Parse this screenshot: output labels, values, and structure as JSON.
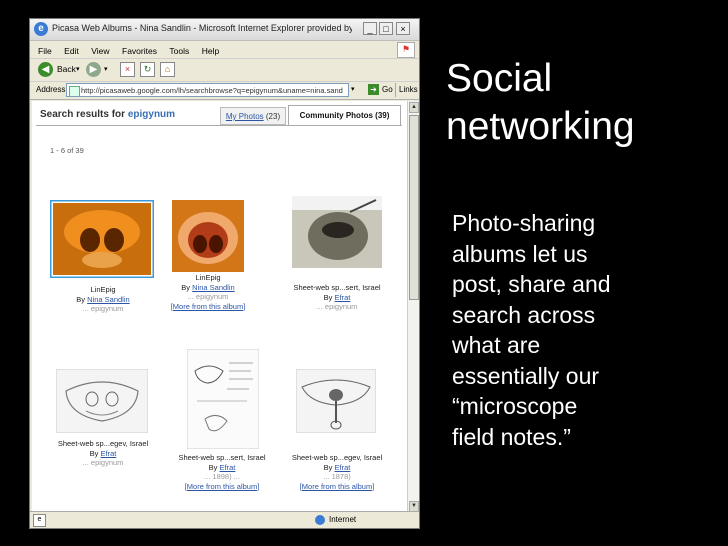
{
  "slide": {
    "title_line1": "Social",
    "title_line2": "networking",
    "body_lines": [
      "Photo-sharing",
      "albums let us",
      "post, share and",
      "search across",
      "what are",
      "essentially our",
      "“microscope",
      "field notes.”"
    ]
  },
  "browser": {
    "title": "Picasa Web Albums - Nina Sandlin - Microsoft Internet Explorer provided by American ...",
    "menu": [
      "File",
      "Edit",
      "View",
      "Favorites",
      "Tools",
      "Help"
    ],
    "back_label": "Back",
    "address_label": "Address",
    "address_value": "http://picasaweb.google.com/lh/searchbrowse?q=epigynum&uname=nina.sand",
    "go_label": "Go",
    "links_label": "Links",
    "status_zone": "Internet"
  },
  "page": {
    "search_prefix": "Search results for",
    "search_term": "epigynum",
    "tab_my_photos": "My Photos",
    "tab_my_photos_count": "(23)",
    "tab_community": "Community Photos (39)",
    "range": "1 - 6 of 39",
    "results": [
      {
        "title": "LinEpig",
        "by": "By",
        "author": "Nina Sandlin",
        "tag": "... epigynum",
        "more": ""
      },
      {
        "title": "LinEpig",
        "by": "By",
        "author": "Nina Sandlin",
        "tag": "... epigynum",
        "more": "[More from this album]"
      },
      {
        "title": "Sheet-web sp...sert, Israel",
        "by": "By",
        "author": "Efrat",
        "tag": "... epigynum",
        "more": ""
      },
      {
        "title": "Sheet-web sp...egev, Israel",
        "by": "By",
        "author": "Efrat",
        "tag": "... epigynum",
        "more": ""
      },
      {
        "title": "Sheet-web sp...sert, Israel",
        "by": "By",
        "author": "Efrat",
        "tag": "... 1898) ...",
        "more": "[More from this album]"
      },
      {
        "title": "Sheet-web sp...egev, Israel",
        "by": "By",
        "author": "Efrat",
        "tag": "... 1878)",
        "more": "[More from this album]"
      }
    ]
  },
  "colors": {
    "slide_bg": "#000000",
    "slide_text": "#ffffff",
    "link": "#2b55a5",
    "selected_thumb_border": "#3a9ad9"
  }
}
